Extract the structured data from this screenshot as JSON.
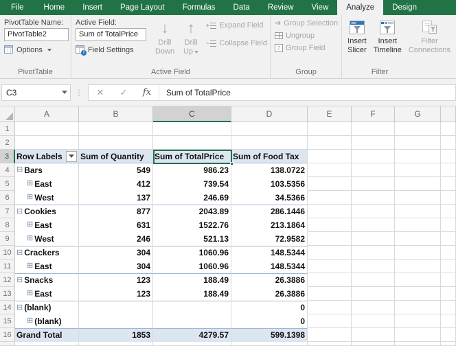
{
  "tabs": {
    "items": [
      "File",
      "Home",
      "Insert",
      "Page Layout",
      "Formulas",
      "Data",
      "Review",
      "View",
      "Analyze",
      "Design"
    ],
    "active": "Analyze"
  },
  "ribbon": {
    "pivottable_group": {
      "label": "PivotTable",
      "name_label": "PivotTable Name:",
      "name_value": "PivotTable2",
      "options_label": "Options"
    },
    "active_field_group": {
      "label": "Active Field",
      "field_label": "Active Field:",
      "field_value": "Sum of TotalPrice",
      "field_settings_label": "Field Settings",
      "drill_down_line1": "Drill",
      "drill_down_line2": "Down",
      "drill_up_line1": "Drill",
      "drill_up_line2": "Up",
      "expand_label": "Expand Field",
      "collapse_label": "Collapse Field"
    },
    "group_group": {
      "label": "Group",
      "group_selection": "Group Selection",
      "ungroup": "Ungroup",
      "group_field": "Group Field"
    },
    "filter_group": {
      "label": "Filter",
      "insert_slicer_line1": "Insert",
      "insert_slicer_line2": "Slicer",
      "insert_timeline_line1": "Insert",
      "insert_timeline_line2": "Timeline",
      "filter_connections_line1": "Filter",
      "filter_connections_line2": "Connections"
    }
  },
  "formula_bar": {
    "name_box": "C3",
    "cancel": "✕",
    "enter": "✓",
    "fx": "fx",
    "formula": "Sum of TotalPrice"
  },
  "grid": {
    "columns": [
      "A",
      "B",
      "C",
      "D",
      "E",
      "F",
      "G"
    ],
    "selected_cell": "C3",
    "selected_column": "C",
    "selected_row": 3
  },
  "pivot": {
    "headers": [
      "Row Labels",
      "Sum of Quantity",
      "Sum of TotalPrice",
      "Sum of Food Tax"
    ],
    "rows": [
      {
        "row": 4,
        "label": "Bars",
        "level": 0,
        "expand": "minus",
        "qty": "549",
        "total": "986.23",
        "tax": "138.0722"
      },
      {
        "row": 5,
        "label": "East",
        "level": 1,
        "expand": "plus",
        "qty": "412",
        "total": "739.54",
        "tax": "103.5356"
      },
      {
        "row": 6,
        "label": "West",
        "level": 1,
        "expand": "plus",
        "qty": "137",
        "total": "246.69",
        "tax": "34.5366"
      },
      {
        "row": 7,
        "label": "Cookies",
        "level": 0,
        "expand": "minus",
        "qty": "877",
        "total": "2043.89",
        "tax": "286.1446"
      },
      {
        "row": 8,
        "label": "East",
        "level": 1,
        "expand": "plus",
        "qty": "631",
        "total": "1522.76",
        "tax": "213.1864"
      },
      {
        "row": 9,
        "label": "West",
        "level": 1,
        "expand": "plus",
        "qty": "246",
        "total": "521.13",
        "tax": "72.9582"
      },
      {
        "row": 10,
        "label": "Crackers",
        "level": 0,
        "expand": "minus",
        "qty": "304",
        "total": "1060.96",
        "tax": "148.5344"
      },
      {
        "row": 11,
        "label": "East",
        "level": 1,
        "expand": "plus",
        "qty": "304",
        "total": "1060.96",
        "tax": "148.5344"
      },
      {
        "row": 12,
        "label": "Snacks",
        "level": 0,
        "expand": "minus",
        "qty": "123",
        "total": "188.49",
        "tax": "26.3886"
      },
      {
        "row": 13,
        "label": "East",
        "level": 1,
        "expand": "plus",
        "qty": "123",
        "total": "188.49",
        "tax": "26.3886"
      },
      {
        "row": 14,
        "label": "(blank)",
        "level": 0,
        "expand": "minus",
        "qty": "",
        "total": "",
        "tax": "0"
      },
      {
        "row": 15,
        "label": "(blank)",
        "level": 1,
        "expand": "plus",
        "qty": "",
        "total": "",
        "tax": "0"
      },
      {
        "row": 16,
        "label": "Grand Total",
        "level": -1,
        "expand": "none",
        "qty": "1853",
        "total": "4279.57",
        "tax": "599.1398"
      }
    ],
    "group_border_rows": [
      7,
      10,
      12,
      14,
      16
    ]
  },
  "colors": {
    "excel_green": "#217346",
    "pivot_header_blue": "#dce6f1",
    "slicer_icon_blue": "#2e75b5"
  }
}
